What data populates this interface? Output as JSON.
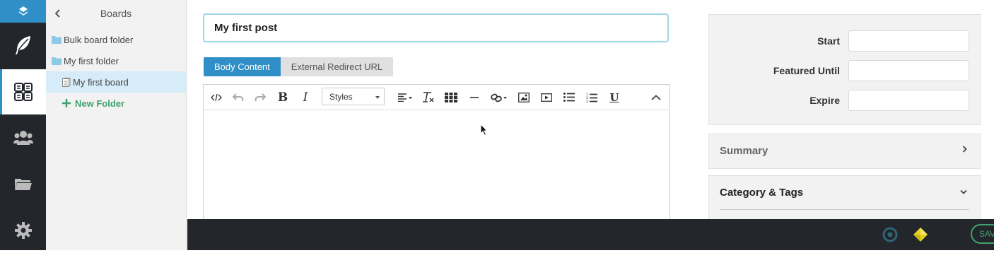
{
  "boards_panel": {
    "title": "Boards",
    "items": [
      {
        "label": "Bulk board folder",
        "type": "folder"
      },
      {
        "label": "My first folder",
        "type": "folder"
      },
      {
        "label": "My first board",
        "type": "board",
        "selected": true
      },
      {
        "label": "New Folder",
        "type": "action"
      }
    ]
  },
  "editor": {
    "title_value": "My first post",
    "tabs": [
      {
        "label": "Body Content",
        "active": true
      },
      {
        "label": "External Redirect URL",
        "active": false
      }
    ],
    "styles_select": "Styles",
    "toolbar_icons": [
      "source-code-icon",
      "undo-icon",
      "redo-icon",
      "bold-icon",
      "italic-icon",
      "align-icon",
      "clear-format-icon",
      "table-icon",
      "horizontal-rule-icon",
      "link-icon",
      "image-icon",
      "video-icon",
      "bulleted-list-icon",
      "numbered-list-icon",
      "underline-icon",
      "collapse-toolbar-icon"
    ]
  },
  "sidebar": {
    "dates": [
      {
        "label": "Start",
        "value": ""
      },
      {
        "label": "Featured Until",
        "value": ""
      },
      {
        "label": "Expire",
        "value": ""
      }
    ],
    "summary": {
      "title": "Summary",
      "state": "collapsed"
    },
    "category": {
      "title": "Category & Tags",
      "state": "expanded"
    }
  },
  "bottom_bar": {
    "save_label": "SAVE"
  },
  "colors": {
    "accent": "#2f8fc6",
    "save": "#3ea36b",
    "dark": "#23262b"
  }
}
